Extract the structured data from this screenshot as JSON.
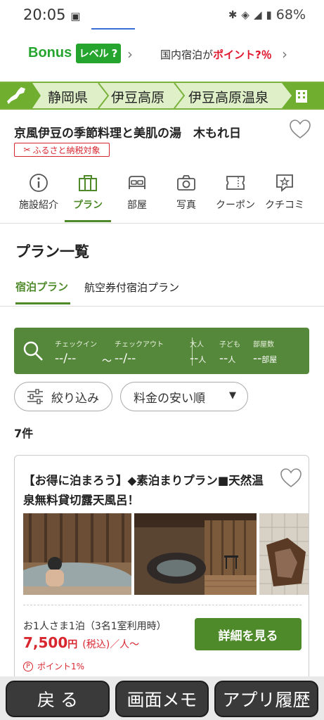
{
  "status_bar": {
    "time": "20:05",
    "battery": "68%"
  },
  "bonus": {
    "label": "Bonus",
    "level": "レベル",
    "level_q": "?",
    "domestic_prefix": "国内宿泊が",
    "domestic_point": "ポイント?％"
  },
  "breadcrumb": [
    "静岡県",
    "伊豆高原",
    "伊豆高原温泉"
  ],
  "hotel": {
    "name": "京風伊豆の季節料理と美肌の湯　木もれ日",
    "furusato": "ふるさと納税対象"
  },
  "nav_tabs": [
    {
      "label": "施設紹介",
      "icon": "info-icon"
    },
    {
      "label": "プラン",
      "icon": "bag-icon",
      "active": true
    },
    {
      "label": "部屋",
      "icon": "bed-icon"
    },
    {
      "label": "写真",
      "icon": "camera-icon"
    },
    {
      "label": "クーポン",
      "icon": "coupon-icon"
    },
    {
      "label": "クチコミ",
      "icon": "review-icon"
    }
  ],
  "plans": {
    "title": "プラン一覧",
    "tabs": [
      "宿泊プラン",
      "航空券付宿泊プラン"
    ]
  },
  "search": {
    "checkin_label": "チェックイン",
    "checkin_value": "--/--",
    "tilde": "〜",
    "checkout_label": "チェックアウト",
    "checkout_value": "--/--",
    "adult_label": "大人",
    "adult_value": "--",
    "adult_unit": "人",
    "child_label": "子ども",
    "child_value": "--",
    "child_unit": "人",
    "rooms_label": "部屋数",
    "rooms_value": "--",
    "rooms_unit": "部屋"
  },
  "filters": {
    "narrow": "絞り込み",
    "sort": "料金の安い順"
  },
  "count": "7件",
  "plan_card": {
    "title": "【お得に泊まろう】◆素泊まりプラン■天然温泉無料貸切露天風呂！",
    "per": "お1人さま1泊（3名1室利用時）",
    "price": "7,500",
    "yen": "円",
    "tax": "(税込)／人〜",
    "detail_button": "詳細を見る",
    "point_mark": "P",
    "point": "ポイント1%"
  },
  "bottom_nav": {
    "back": "戻 る",
    "memo": "画面メモ",
    "history": "アプリ履歴"
  },
  "colors": {
    "green": "#4e8a2a",
    "red": "#d8262f",
    "bonus_green": "#25a52e"
  }
}
